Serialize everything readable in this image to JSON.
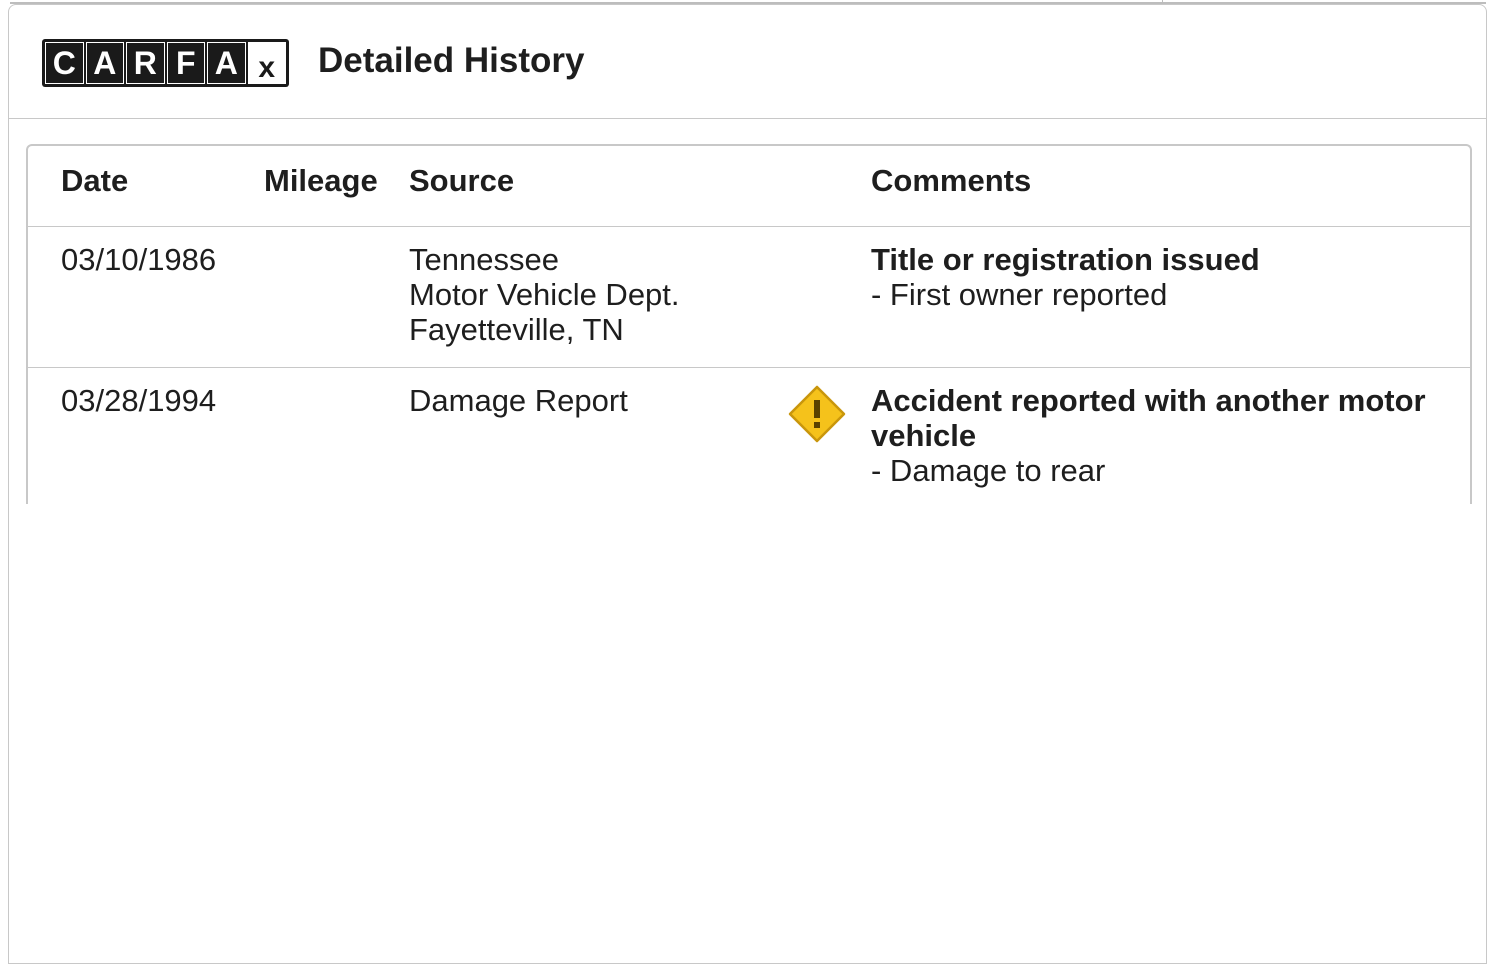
{
  "header": {
    "logo_letters": [
      "C",
      "A",
      "R",
      "F",
      "A",
      "x"
    ],
    "title": "Detailed History"
  },
  "table": {
    "columns": {
      "date": "Date",
      "mileage": "Mileage",
      "source": "Source",
      "comments": "Comments"
    },
    "rows": [
      {
        "date": "03/10/1986",
        "mileage": "",
        "source_lines": [
          "Tennessee",
          "Motor Vehicle Dept.",
          "Fayetteville, TN"
        ],
        "alert": false,
        "comment_title": "Title or registration issued",
        "comment_detail": "- First owner reported"
      },
      {
        "date": "03/28/1994",
        "mileage": "",
        "source_lines": [
          "Damage Report"
        ],
        "alert": true,
        "alert_icon": "warning-diamond-icon",
        "comment_title_lines": [
          "Accident reported with another motor",
          "vehicle"
        ],
        "comment_detail": "- Damage to rear"
      }
    ]
  },
  "colors": {
    "alert_fill": "#f5c21b",
    "alert_border": "#c9960c",
    "alert_mark": "#5a4200",
    "border": "#c8c8c8",
    "text": "#1e1e1e"
  }
}
